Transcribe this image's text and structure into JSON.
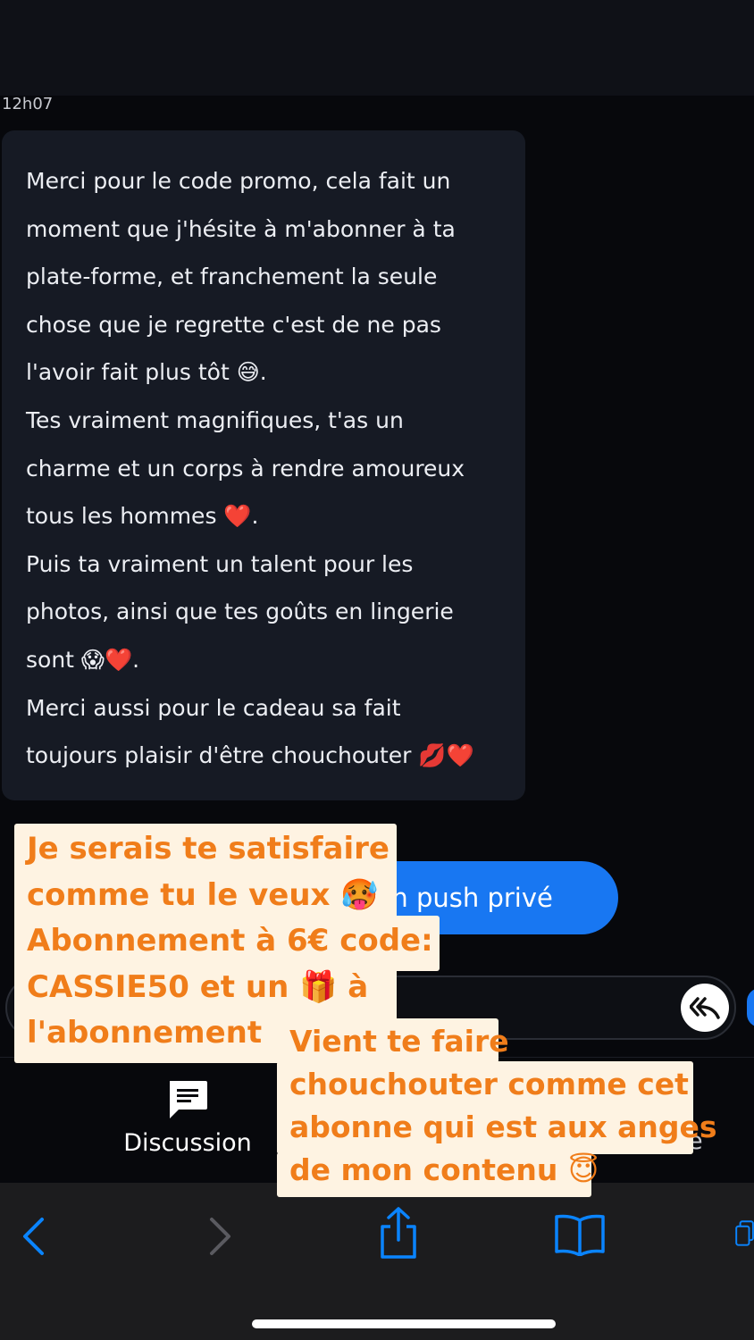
{
  "timestamp": "12h07",
  "message": {
    "lines": [
      "Merci pour le code promo, cela fait un",
      "moment que j'hésite à m'abonner à ta",
      "plate-forme, et franchement la seule",
      "chose que je regrette c'est de ne pas",
      "l'avoir fait plus tôt 😅.",
      "Tes vraiment magnifiques, t'as un",
      "charme et un corps à rendre amoureux",
      "tous les hommes ❤️.",
      "Puis ta vraiment un talent pour les",
      "photos, ainsi que tes goûts en lingerie",
      "sont 😱❤️.",
      "Merci aussi pour le cadeau sa fait",
      "toujours plaisir d'être chouchouter 💋❤️"
    ]
  },
  "push_button": {
    "label": "un push privé"
  },
  "tabbar": {
    "discussion_label": "Discussion",
    "partial_label": "e"
  },
  "overlay_1": {
    "lines": [
      "Je serais te satisfaire",
      "comme tu le veux 🥵",
      "Abonnement à 6€ code:",
      "CASSIE50 et un 🎁 à",
      "l'abonnement"
    ]
  },
  "overlay_2": {
    "lines": [
      "Vient te faire",
      "chouchouter comme cet",
      "abonne qui est aux anges",
      "de mon contenu 😇"
    ]
  },
  "colors": {
    "accent_blue": "#1877f2",
    "overlay_text": "#f07d1a",
    "overlay_bg": "#fef3e2",
    "safari_blue": "#0a84ff"
  },
  "icons": [
    "chat-bubble-icon",
    "reply-all-icon",
    "back-arrow-icon",
    "forward-arrow-icon",
    "share-icon",
    "bookmarks-icon",
    "tabs-icon"
  ]
}
